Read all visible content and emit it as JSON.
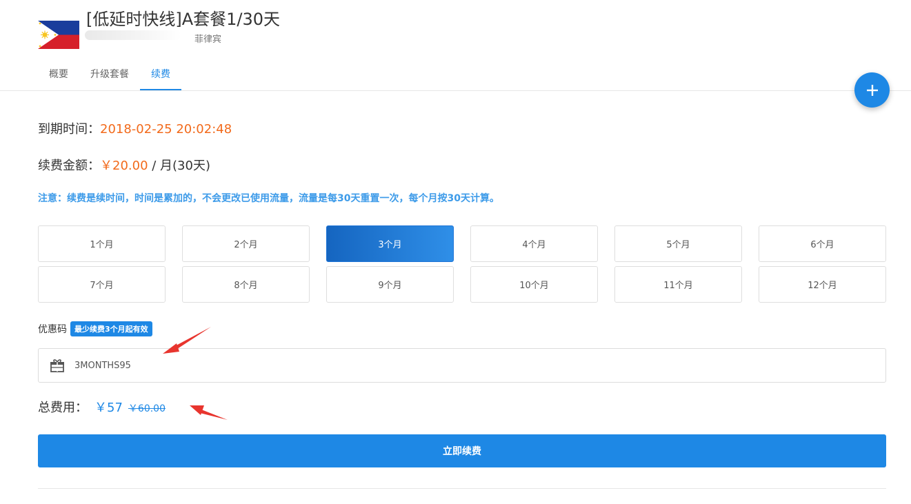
{
  "product": {
    "title": "[低延时快线]A套餐1/30天",
    "region": "菲律宾",
    "flag_icon": "philippines-flag"
  },
  "tabs": [
    {
      "label": "概要",
      "active": false
    },
    {
      "label": "升级套餐",
      "active": false
    },
    {
      "label": "续费",
      "active": true
    }
  ],
  "fab": {
    "icon": "plus-icon"
  },
  "expire": {
    "label": "到期时间：",
    "value": "2018-02-25 20:02:48"
  },
  "renew": {
    "label": "续费金额：",
    "price": "￥20.00",
    "unit": " / 月(30天)"
  },
  "notice": "注意：续费是续时间，时间是累加的，不会更改已使用流量，流量是每30天重置一次，每个月按30天计算。",
  "durations": [
    {
      "label": "1个月",
      "selected": false
    },
    {
      "label": "2个月",
      "selected": false
    },
    {
      "label": "3个月",
      "selected": true
    },
    {
      "label": "4个月",
      "selected": false
    },
    {
      "label": "5个月",
      "selected": false
    },
    {
      "label": "6个月",
      "selected": false
    },
    {
      "label": "7个月",
      "selected": false
    },
    {
      "label": "8个月",
      "selected": false
    },
    {
      "label": "9个月",
      "selected": false
    },
    {
      "label": "10个月",
      "selected": false
    },
    {
      "label": "11个月",
      "selected": false
    },
    {
      "label": "12个月",
      "selected": false
    }
  ],
  "coupon": {
    "label": "优惠码",
    "badge": "最少续费3个月起有效",
    "value": "3MONTHS95",
    "icon": "gift-icon"
  },
  "total": {
    "label": "总费用：",
    "price": "￥57",
    "original": "￥60.00"
  },
  "submit_label": "立即续费",
  "colors": {
    "accent": "#1e88e5",
    "price_orange": "#f26a1b",
    "annotation_arrow": "#e8352e"
  }
}
